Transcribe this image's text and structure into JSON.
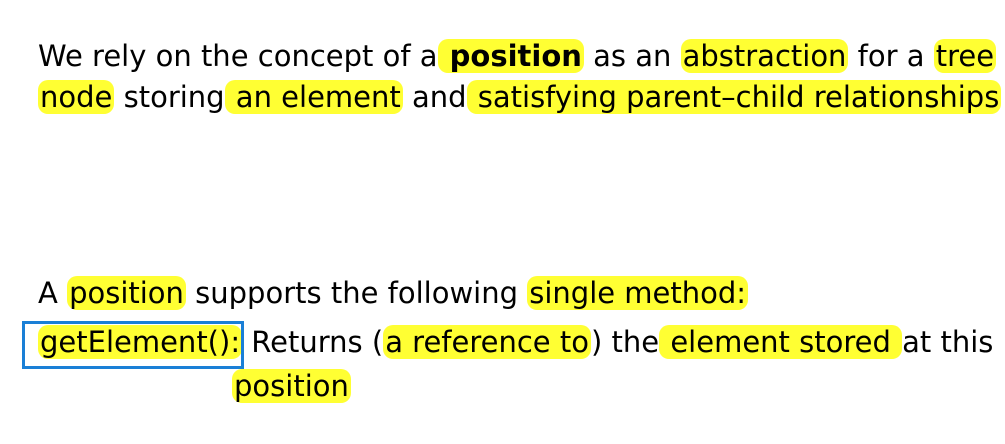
{
  "paragraph1": {
    "line1": {
      "seg1": "We rely on the concept of a",
      "hl1": " position",
      "seg2": " as an ",
      "hl2": "abstraction",
      "seg3": " for a ",
      "hl3": "tree"
    },
    "line2": {
      "hl1": "node",
      "seg1": " storing",
      "hl2": " an element",
      "seg2": " and",
      "hl3": " satisfying parent–child relationships"
    }
  },
  "paragraph2": {
    "seg1": "A ",
    "hl1": "position",
    "seg2": " supports the following ",
    "hl2": "single method:"
  },
  "method": {
    "name": "getElement():",
    "desc1": " Returns (",
    "hl1": "a reference to",
    "desc2": ") the",
    "hl2": " element stored ",
    "desc3": "at this",
    "hl3": "position"
  },
  "colors": {
    "highlight": "#ffff33",
    "box_border": "#1a7fd6"
  }
}
